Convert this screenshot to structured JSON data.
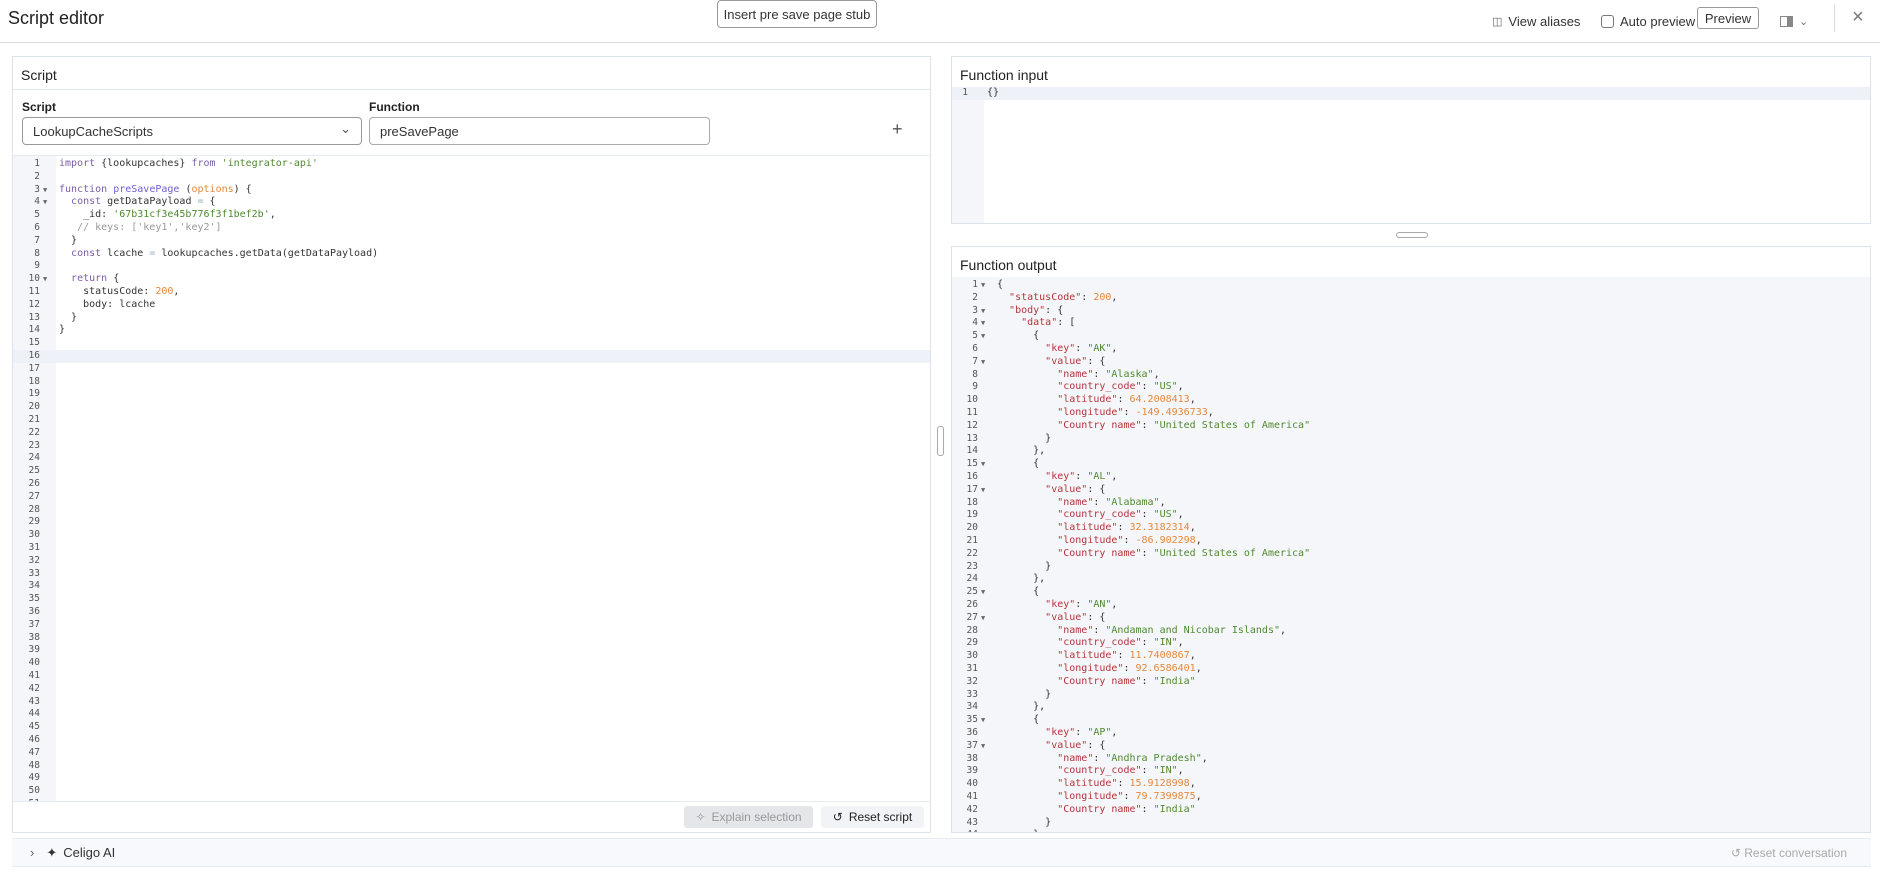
{
  "header": {
    "title": "Script editor",
    "view_aliases": "View aliases",
    "auto_preview": "Auto preview",
    "auto_preview_checked": false,
    "preview": "Preview"
  },
  "script_panel": {
    "title": "Script",
    "script_label": "Script",
    "script_value": "LookupCacheScripts",
    "function_label": "Function",
    "function_value": "preSavePage",
    "insert_stub": "Insert pre save page stub",
    "add": "+",
    "explain": "Explain selection",
    "reset": "Reset script",
    "total_lines": 51,
    "active_line": 16,
    "fold_lines": [
      3,
      4,
      10
    ],
    "code": [
      "import {lookupcaches} from 'integrator-api'",
      "",
      "function preSavePage (options) {",
      "  const getDataPayload = {",
      "    _id: '67b31cf3e45b776f3f1bef2b',",
      "   // keys: ['key1','key2']",
      "  }",
      "  const lcache = lookupcaches.getData(getDataPayload)",
      "",
      "  return {",
      "    statusCode: 200,",
      "    body: lcache",
      "  }",
      "}"
    ]
  },
  "input_panel": {
    "title": "Function input",
    "code": [
      "{}"
    ]
  },
  "output_panel": {
    "title": "Function output",
    "fold_lines": [
      1,
      3,
      4,
      5,
      7,
      15,
      17,
      25,
      27,
      35,
      37
    ],
    "code": [
      "{",
      "  \"statusCode\": 200,",
      "  \"body\": {",
      "    \"data\": [",
      "      {",
      "        \"key\": \"AK\",",
      "        \"value\": {",
      "          \"name\": \"Alaska\",",
      "          \"country_code\": \"US\",",
      "          \"latitude\": 64.2008413,",
      "          \"longitude\": -149.4936733,",
      "          \"Country name\": \"United States of America\"",
      "        }",
      "      },",
      "      {",
      "        \"key\": \"AL\",",
      "        \"value\": {",
      "          \"name\": \"Alabama\",",
      "          \"country_code\": \"US\",",
      "          \"latitude\": 32.3182314,",
      "          \"longitude\": -86.902298,",
      "          \"Country name\": \"United States of America\"",
      "        }",
      "      },",
      "      {",
      "        \"key\": \"AN\",",
      "        \"value\": {",
      "          \"name\": \"Andaman and Nicobar Islands\",",
      "          \"country_code\": \"IN\",",
      "          \"latitude\": 11.7400867,",
      "          \"longitude\": 92.6586401,",
      "          \"Country name\": \"India\"",
      "        }",
      "      },",
      "      {",
      "        \"key\": \"AP\",",
      "        \"value\": {",
      "          \"name\": \"Andhra Pradesh\",",
      "          \"country_code\": \"IN\",",
      "          \"latitude\": 15.9128998,",
      "          \"longitude\": 79.7399875,",
      "          \"Country name\": \"India\"",
      "        }",
      "      },"
    ]
  },
  "ai_bar": {
    "label": "Celigo AI",
    "reset_conversation": "Reset conversation"
  }
}
